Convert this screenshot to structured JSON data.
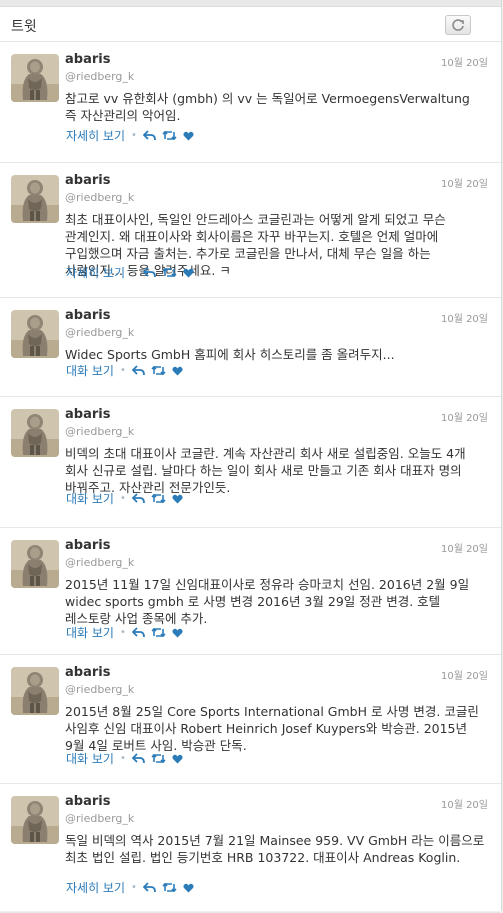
{
  "header": {
    "title": "트윗",
    "refresh_icon": "refresh-icon"
  },
  "tweets": [
    {
      "name": "abaris",
      "handle": "@riedberg_k",
      "time": "10월 20일",
      "text": "참고로 vv 유한회사 (gmbh) 의 vv 는 독일어로 VermoegensVerwaltung 즉 자산관리의 악어임.",
      "action_label": "자세히 보기"
    },
    {
      "name": "abaris",
      "handle": "@riedberg_k",
      "time": "10월 20일",
      "text": "최초 대표이사인, 독일인 안드레아스 코글린과는 어떻게 알게 되었고 무슨 관계인지. 왜 대표이사와 회사이름은 자꾸 바꾸는지. 호텔은 언제 얼마에 구입했으며 자금 출처는. 추가로 코글린을 만나서, 대체 무슨 일을 하는 사람인지... 등을 알려주세요. ㅋ",
      "action_label": "자세히 보기"
    },
    {
      "name": "abaris",
      "handle": "@riedberg_k",
      "time": "10월 20일",
      "text": "Widec Sports GmbH 홈피에 회사 히스토리를 좀 올려두지...",
      "action_label": "대화 보기"
    },
    {
      "name": "abaris",
      "handle": "@riedberg_k",
      "time": "10월 20일",
      "text": "비덱의 초대 대표이사 코글란. 계속 자산관리 회사 새로 설립중임. 오늘도 4개 회사 신규로 설립. 날마다 하는 일이 회사 새로 만들고 기존 회사 대표자 명의 바꿔주고. 자산관리 전문가인듯.",
      "action_label": "대화 보기"
    },
    {
      "name": "abaris",
      "handle": "@riedberg_k",
      "time": "10월 20일",
      "text": "2015년 11월 17일 신임대표이사로 정유라 승마코치 선임. 2016년 2월 9일 widec sports gmbh 로 사명 변경 2016년 3월 29일 정관 변경. 호텔 레스토랑 사업 종목에 추가.",
      "action_label": "대화 보기"
    },
    {
      "name": "abaris",
      "handle": "@riedberg_k",
      "time": "10월 20일",
      "text": "2015년 8월 25일 Core Sports International GmbH 로 사명 변경. 코글린 사임후 신임 대표이사 Robert Heinrich Josef Kuypers와 박승관. 2015년 9월 4일 로버트 사임. 박승관 단독.",
      "action_label": "대화 보기"
    },
    {
      "name": "abaris",
      "handle": "@riedberg_k",
      "time": "10월 20일",
      "text": "독일 비덱의 역사 2015년 7월 21일 Mainsee 959. VV GmbH 라는 이름으로 최초 법인 설립. 법인 등기번호 HRB 103722. 대표이사 Andreas Koglin.",
      "action_label": "자세히 보기"
    }
  ],
  "colors": {
    "link": "#2b7bb9",
    "muted": "#999999",
    "text": "#333333"
  },
  "icons": [
    "avatar-statue-image",
    "reply-icon",
    "retweet-icon",
    "like-icon"
  ]
}
